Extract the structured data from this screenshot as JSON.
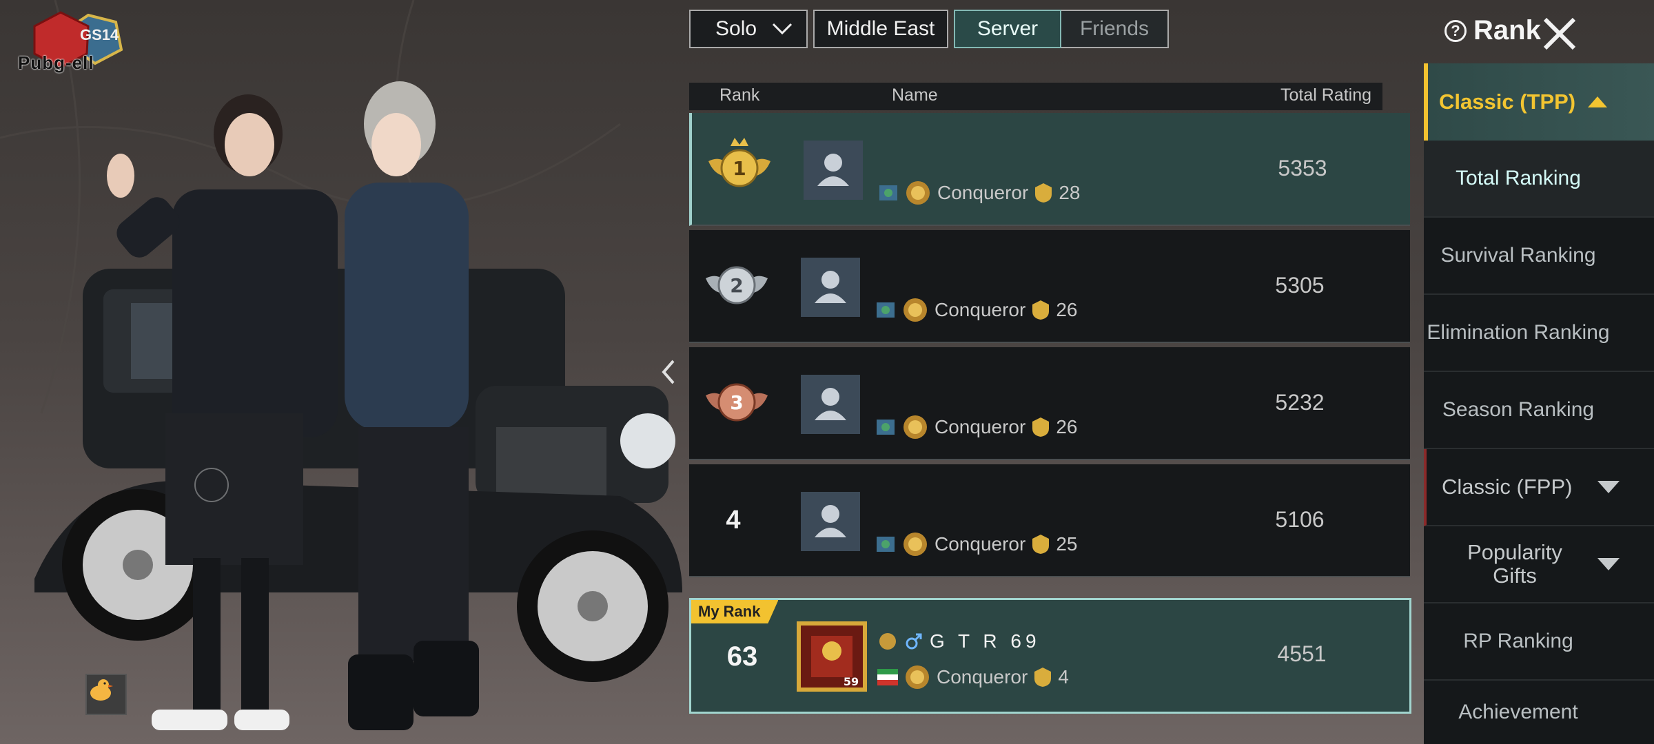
{
  "logo": {
    "label": "Pubg-ell",
    "season": "GS14"
  },
  "filters": {
    "mode": "Solo",
    "region": "Middle East",
    "scope_tabs": [
      {
        "label": "Server",
        "active": true
      },
      {
        "label": "Friends",
        "active": false
      }
    ]
  },
  "header": {
    "title": "Rank"
  },
  "table": {
    "columns": {
      "rank": "Rank",
      "name": "Name",
      "rating": "Total Rating"
    },
    "rows": [
      {
        "rank": "1",
        "tier": "Conqueror",
        "stars": "28",
        "rating": "5353"
      },
      {
        "rank": "2",
        "tier": "Conqueror",
        "stars": "26",
        "rating": "5305"
      },
      {
        "rank": "3",
        "tier": "Conqueror",
        "stars": "26",
        "rating": "5232"
      },
      {
        "rank": "4",
        "tier": "Conqueror",
        "stars": "25",
        "rating": "5106"
      }
    ],
    "my_rank": {
      "badge": "My Rank",
      "rank": "63",
      "name": "G T R 69",
      "level": "59",
      "tier": "Conqueror",
      "stars": "4",
      "rating": "4551"
    }
  },
  "sidebar": {
    "open_category": "Classic (TPP)",
    "items": [
      {
        "label": "Total Ranking",
        "active": true
      },
      {
        "label": "Survival Ranking",
        "active": false
      },
      {
        "label": "Elimination Ranking",
        "active": false
      },
      {
        "label": "Season Ranking",
        "active": false
      }
    ],
    "categories": [
      {
        "label": "Classic (FPP)",
        "expandable": true
      },
      {
        "label": "Popularity Gifts",
        "expandable": true
      },
      {
        "label": "RP Ranking",
        "expandable": false
      },
      {
        "label": "Achievement",
        "expandable": false
      }
    ]
  },
  "colors": {
    "accent_yellow": "#f2c230",
    "active_teal": "#2c4644",
    "gold": "#d8a93a"
  }
}
